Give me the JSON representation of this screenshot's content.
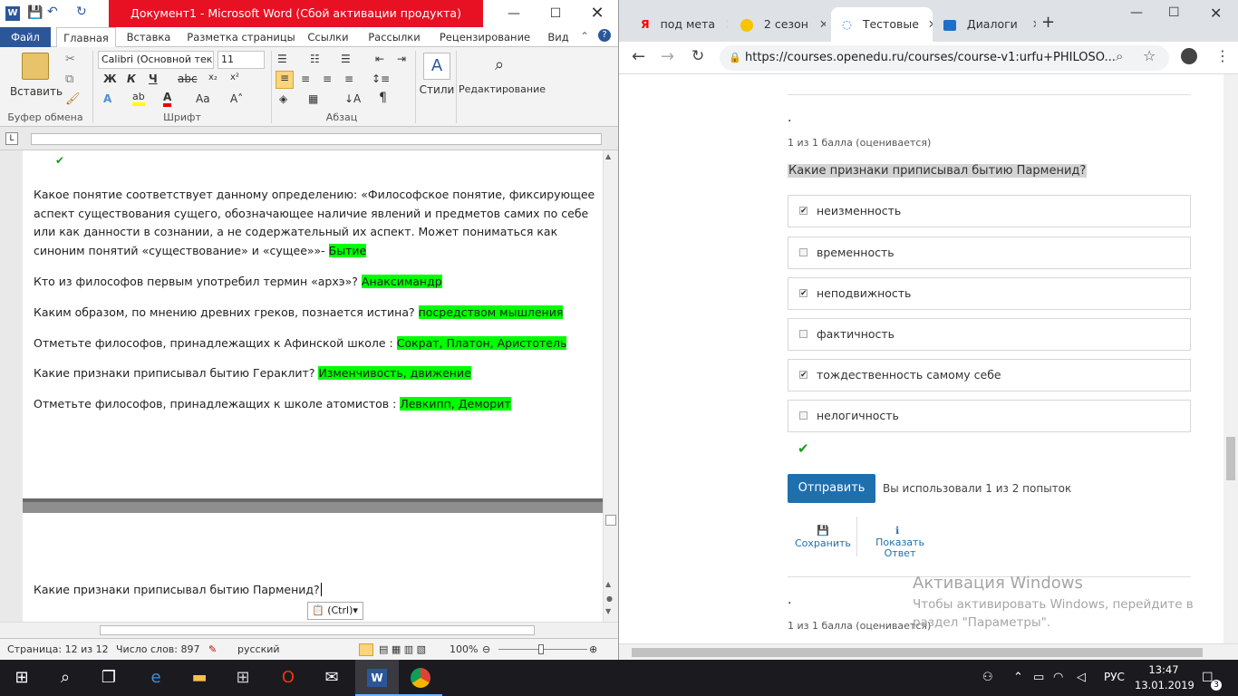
{
  "word": {
    "title": "Документ1 - Microsoft Word (Сбой активации продукта)",
    "tabs": [
      "Файл",
      "Главная",
      "Вставка",
      "Разметка страницы",
      "Ссылки",
      "Рассылки",
      "Рецензирование",
      "Вид"
    ],
    "ribbon": {
      "paste": "Вставить",
      "group_clipboard": "Буфер обмена",
      "group_font": "Шрифт",
      "group_paragraph": "Абзац",
      "font_name": "Calibri (Основной тек",
      "font_size": "11",
      "styles": "Стили",
      "editing": "Редактирование",
      "bold": "Ж",
      "italic": "К",
      "underline": "Ч"
    },
    "doc": {
      "p1_text": "Какое понятие соответствует данному определению: «Философское понятие, фиксирующее аспект существования сущего, обозначающее наличие явлений и предметов самих по себе или как данности в сознании, а не содержательный их аспект. Может пониматься как синоним понятий «существование» и «сущее»»- ",
      "p1_answer": "Бытие",
      "p2_text": "Кто из философов первым употребил термин «архэ»? ",
      "p2_answer": "Анаксимандр",
      "p3_text": "Каким образом, по мнению древних греков, познается истина? ",
      "p3_answer": "посредством мышления",
      "p4_text": "Отметьте философов, принадлежащих к Афинской школе : ",
      "p4_answer": "Сократ, Платон, Аристотель",
      "p5_text": "Какие признаки приписывал бытию Гераклит? ",
      "p5_answer": "Изменчивость, движение",
      "p6_text": "Отметьте философов, принадлежащих к школе атомистов : ",
      "p6_answer": "Левкипп, Деморит",
      "p7_text": "Какие признаки приписывал бытию Парменид?",
      "paste_tag": "(Ctrl)"
    },
    "status": {
      "page": "Страница: 12 из 12",
      "words": "Число слов: 897",
      "lang": "русский",
      "zoom": "100%"
    }
  },
  "chrome": {
    "tabs": [
      "под мета",
      "2 сезон",
      "Тестовые",
      "Диалоги"
    ],
    "url": "https://courses.openedu.ru/courses/course-v1:urfu+PHILOSO...",
    "content": {
      "dot1": ".",
      "score1": "1 из 1 балла (оценивается)",
      "question": "Какие признаки приписывал бытию Парменид?",
      "options": [
        {
          "label": "неизменность",
          "checked": true
        },
        {
          "label": "временность",
          "checked": false
        },
        {
          "label": "неподвижность",
          "checked": true
        },
        {
          "label": "фактичность",
          "checked": false
        },
        {
          "label": "тождественность самому себе",
          "checked": true
        },
        {
          "label": "нелогичность",
          "checked": false
        }
      ],
      "submit": "Отправить",
      "attempts": "Вы использовали 1 из 2 попыток",
      "save": "Сохранить",
      "show_answer_1": "Показать",
      "show_answer_2": "Ответ",
      "dot2": ".",
      "score2": "1 из 1 балла (оценивается)",
      "activation_title": "Активация Windows",
      "activation_text": "Чтобы активировать Windows, перейдите в раздел \"Параметры\"."
    }
  },
  "taskbar": {
    "lang": "РУС",
    "time": "13:47",
    "date": "13.01.2019",
    "notif_count": "3"
  },
  "colors": {
    "word_blue": "#2b579a",
    "highlight": "#00ff00",
    "title_red": "#e81123",
    "submit": "#1f6fad"
  }
}
